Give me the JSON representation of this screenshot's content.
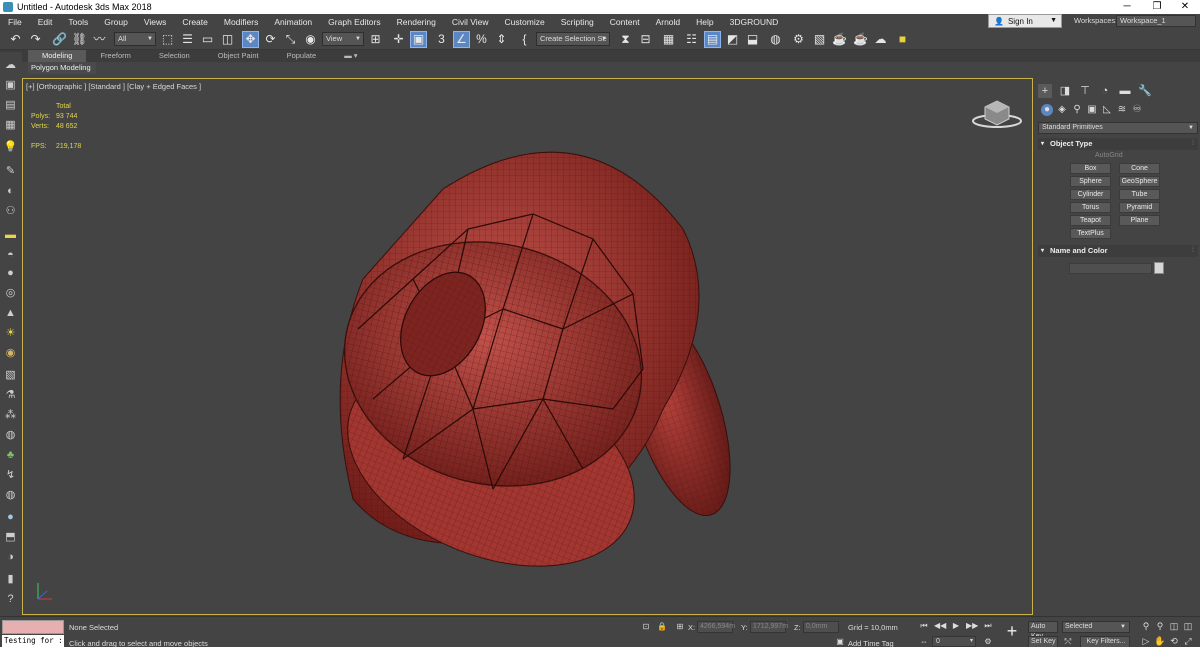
{
  "window": {
    "title": "Untitled - Autodesk 3ds Max 2018",
    "minimize": "─",
    "restore": "❐",
    "close": "✕"
  },
  "menu": [
    "File",
    "Edit",
    "Tools",
    "Group",
    "Views",
    "Create",
    "Modifiers",
    "Animation",
    "Graph Editors",
    "Rendering",
    "Civil View",
    "Customize",
    "Scripting",
    "Content",
    "Arnold",
    "Help",
    "3DGROUND"
  ],
  "account": {
    "signin": "Sign In",
    "workspaces_label": "Workspaces:",
    "workspace": "Workspace_1"
  },
  "toolbar": {
    "filter": "All",
    "ref_coord": "View",
    "selection_set": "Create Selection Se"
  },
  "ribbon": {
    "tabs": [
      "Modeling",
      "Freeform",
      "Selection",
      "Object Paint",
      "Populate"
    ],
    "active_tab": "Modeling",
    "sub_label": "Polygon Modeling"
  },
  "viewport": {
    "label": "[+] [Orthographic ] [Standard ] [Clay + Edged Faces ]",
    "stats": {
      "total_label": "Total",
      "polys_label": "Polys:",
      "polys": "93 744",
      "verts_label": "Verts:",
      "verts": "48 652",
      "fps_label": "FPS:",
      "fps": "219,178"
    },
    "model_color": "#a33630",
    "wire_color": "#3a0f0c"
  },
  "command_panel": {
    "category": "Standard Primitives",
    "object_type_title": "Object Type",
    "autogrid": "AutoGrid",
    "primitives": [
      "Box",
      "Cone",
      "Sphere",
      "GeoSphere",
      "Cylinder",
      "Tube",
      "Torus",
      "Pyramid",
      "Teapot",
      "Plane",
      "TextPlus"
    ],
    "name_color_title": "Name and Color"
  },
  "status": {
    "listener": "Testing for :",
    "selection": "None Selected",
    "prompt": "Click and drag to select and move objects",
    "x_label": "X:",
    "x": "4266,594m",
    "y_label": "Y:",
    "y": "1712,997m",
    "z_label": "Z:",
    "z": "0,0mm",
    "grid": "Grid = 10,0mm",
    "time_tag": "Add Time Tag",
    "frame": "0",
    "auto_key": "Auto Key",
    "set_key": "Set Key",
    "key_mode": "Selected",
    "key_filters": "Key Filters..."
  }
}
